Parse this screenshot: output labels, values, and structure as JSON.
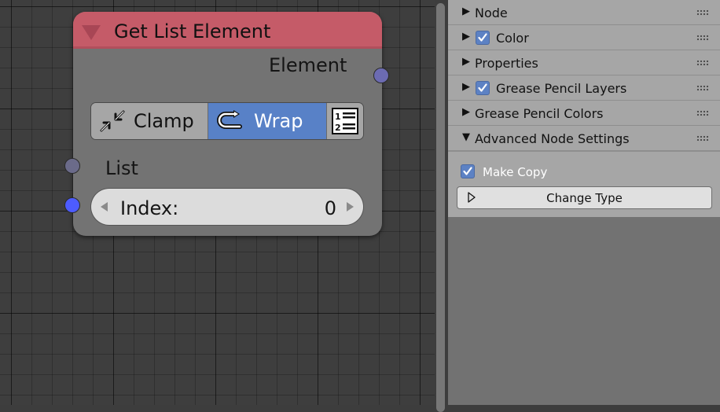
{
  "node": {
    "title": "Get List Element",
    "output_label": "Element",
    "modes": {
      "clamp_label": "Clamp",
      "wrap_label": "Wrap",
      "selected": "Wrap"
    },
    "input_list_label": "List",
    "index": {
      "label": "Index:",
      "value": "0"
    }
  },
  "sidebar": {
    "panels": [
      {
        "label": "Node",
        "expanded": false,
        "checkbox": false
      },
      {
        "label": "Color",
        "expanded": false,
        "checkbox": true
      },
      {
        "label": "Properties",
        "expanded": false,
        "checkbox": false
      },
      {
        "label": "Grease Pencil Layers",
        "expanded": false,
        "checkbox": true
      },
      {
        "label": "Grease Pencil Colors",
        "expanded": false,
        "checkbox": false
      },
      {
        "label": "Advanced Node Settings",
        "expanded": true,
        "checkbox": false
      }
    ],
    "advanced": {
      "make_copy_label": "Make Copy",
      "make_copy_checked": true,
      "change_type_label": "Change Type"
    }
  },
  "colors": {
    "node_header": "#c55b68",
    "node_body": "#737373",
    "selected_mode": "#5881c7",
    "checkbox": "#5d82c4",
    "index_socket": "#4d5cff"
  }
}
